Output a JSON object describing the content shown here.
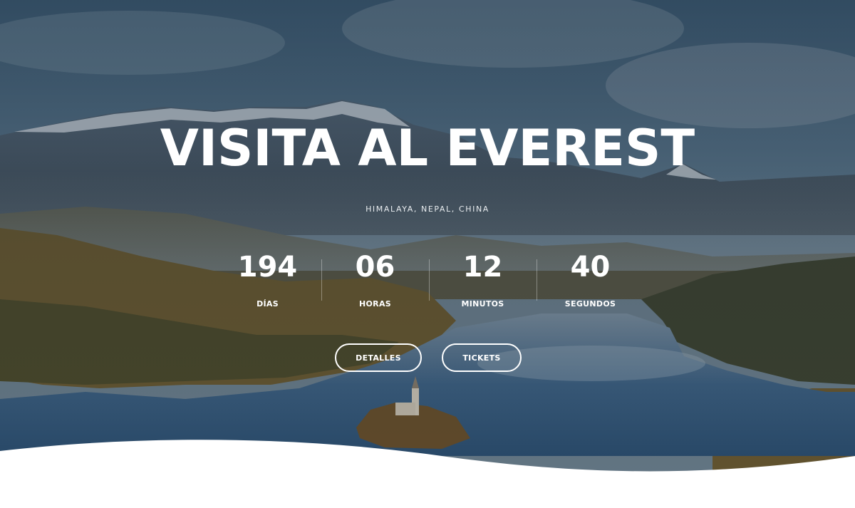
{
  "hero": {
    "title": "VISITA AL EVEREST",
    "subtitle": "HIMALAYA, NEPAL, CHINA"
  },
  "countdown": [
    {
      "value": "194",
      "label": "DÍAS"
    },
    {
      "value": "06",
      "label": "HORAS"
    },
    {
      "value": "12",
      "label": "MINUTOS"
    },
    {
      "value": "40",
      "label": "SEGUNDOS"
    }
  ],
  "buttons": {
    "details": "DETALLES",
    "tickets": "TICKETS"
  },
  "colors": {
    "text": "#ffffff",
    "sky": "#4a6a85",
    "lake": "#3c5f80",
    "forest": "#6b5a2c",
    "wave": "#ffffff"
  }
}
